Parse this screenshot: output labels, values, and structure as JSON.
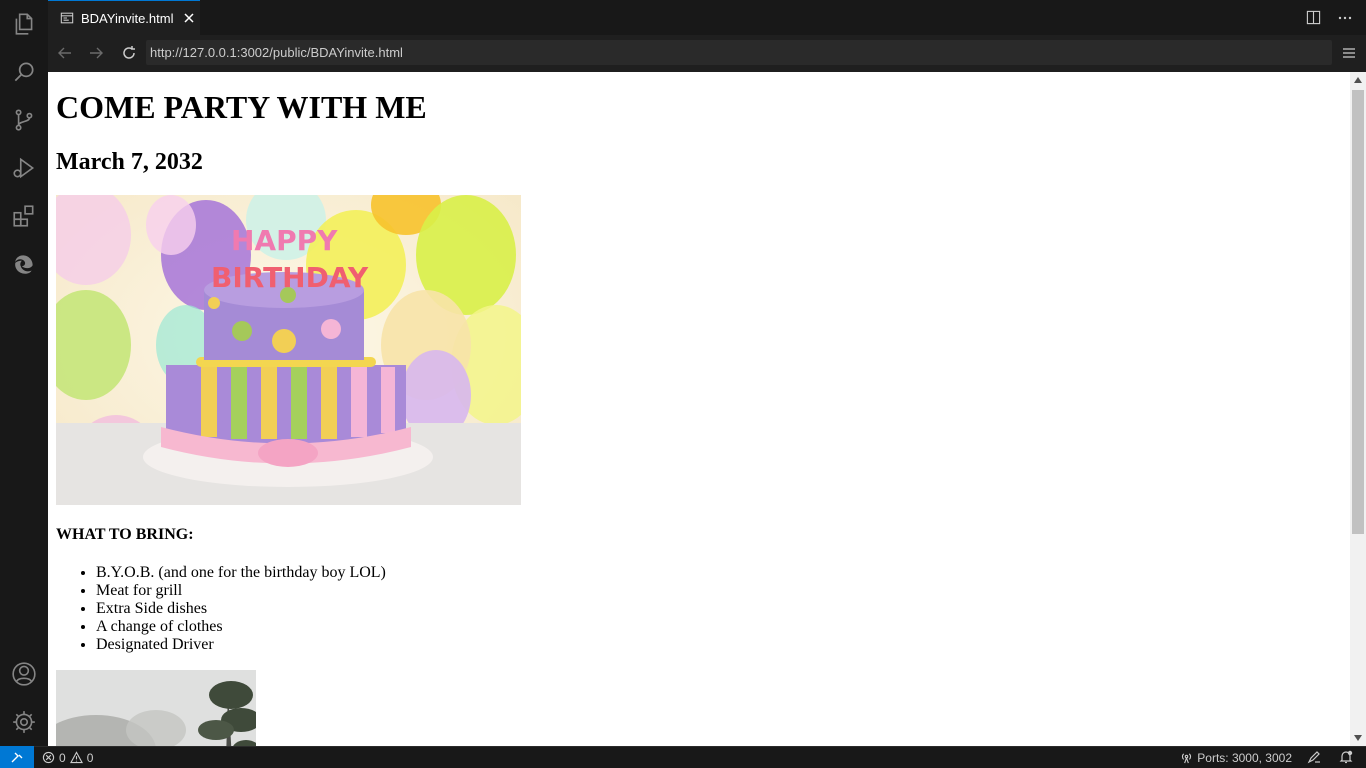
{
  "tab": {
    "title": "BDAYinvite.html"
  },
  "browser": {
    "url": "http://127.0.0.1:3002/public/BDAYinvite.html"
  },
  "page": {
    "heading": "COME PARTY WITH ME",
    "date": "March 7, 2032",
    "balloon_letters_top": "HAPPY",
    "balloon_letters_bottom": "BIRTHDAY",
    "bring_heading": "WHAT TO BRING:",
    "bring_items": [
      "B.Y.O.B. (and one for the birthday boy LOL)",
      "Meat for grill",
      "Extra Side dishes",
      "A change of clothes",
      "Designated Driver"
    ]
  },
  "statusbar": {
    "errors": "0",
    "warnings": "0",
    "ports": "Ports: 3000, 3002"
  },
  "colors": {
    "accent": "#0078d4",
    "chrome_dark": "#181818",
    "editor_bg": "#1f1f1f"
  }
}
